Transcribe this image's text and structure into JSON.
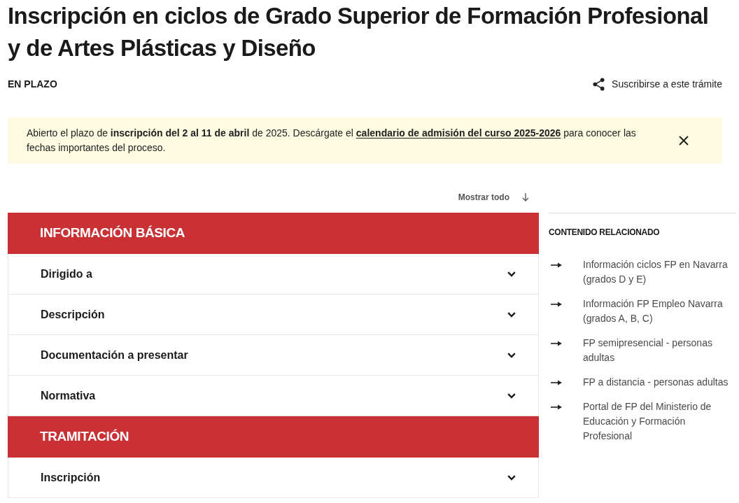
{
  "title": "Inscripción en ciclos de Grado Superior de Formación Profesional y de Artes Plásticas y Diseño",
  "status": "EN PLAZO",
  "subscribe": {
    "label": "Suscribirse a este trámite"
  },
  "notice": {
    "text": "Abierto el plazo de **inscripción del 2 al 11 de abril** de 2025. Descárgate el",
    "link": "calendario de admisión del curso 2025-2026",
    "text_after": "para conocer las fechas importantes del proceso."
  },
  "show_all": {
    "label": "Mostrar todo"
  },
  "sections": [
    {
      "title": "INFORMACIÓN BÁSICA",
      "items": [
        {
          "label": "Dirigido a",
          "expanded": false
        },
        {
          "label": "Descripción",
          "expanded": false
        },
        {
          "label": "Documentación a presentar",
          "expanded": false
        },
        {
          "label": "Normativa",
          "expanded": false
        }
      ]
    },
    {
      "title": "TRAMITACIÓN",
      "items": [
        {
          "label": "Inscripción",
          "expanded": false
        }
      ]
    }
  ],
  "related": {
    "title": "CONTENIDO RELACIONADO",
    "links": [
      "Información ciclos FP en Navarra (grados D y E)",
      "Información FP Empleo Navarra (grados A, B, C)",
      "FP semipresencial - personas adultas",
      "FP a distancia - personas adultas",
      "Portal de FP del Ministerio de Educación y Formación Profesional"
    ]
  }
}
